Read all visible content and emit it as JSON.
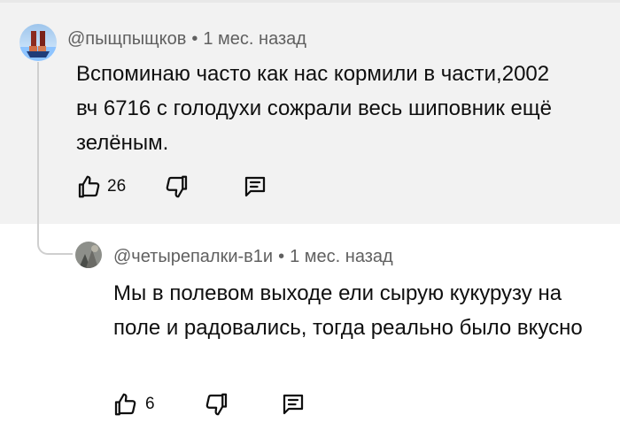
{
  "comments": [
    {
      "handle": "@пыщпыщков",
      "separator": "•",
      "time": "1 мес. назад",
      "text": "Вспоминаю часто как нас кормили в части,2002 вч 6716 с голодухи сожрали весь шиповник ещё зелёным.",
      "likes": "26"
    },
    {
      "handle": "@четырепалки-в1и",
      "separator": "•",
      "time": "1 мес. назад",
      "text": "Мы в полевом выходе ели сырую кукурузу на поле и радовались, тогда реально было вкусно",
      "likes": "6"
    }
  ],
  "icons": {
    "like": "thumb-up-icon",
    "dislike": "thumb-down-icon",
    "reply": "reply-comment-icon"
  }
}
